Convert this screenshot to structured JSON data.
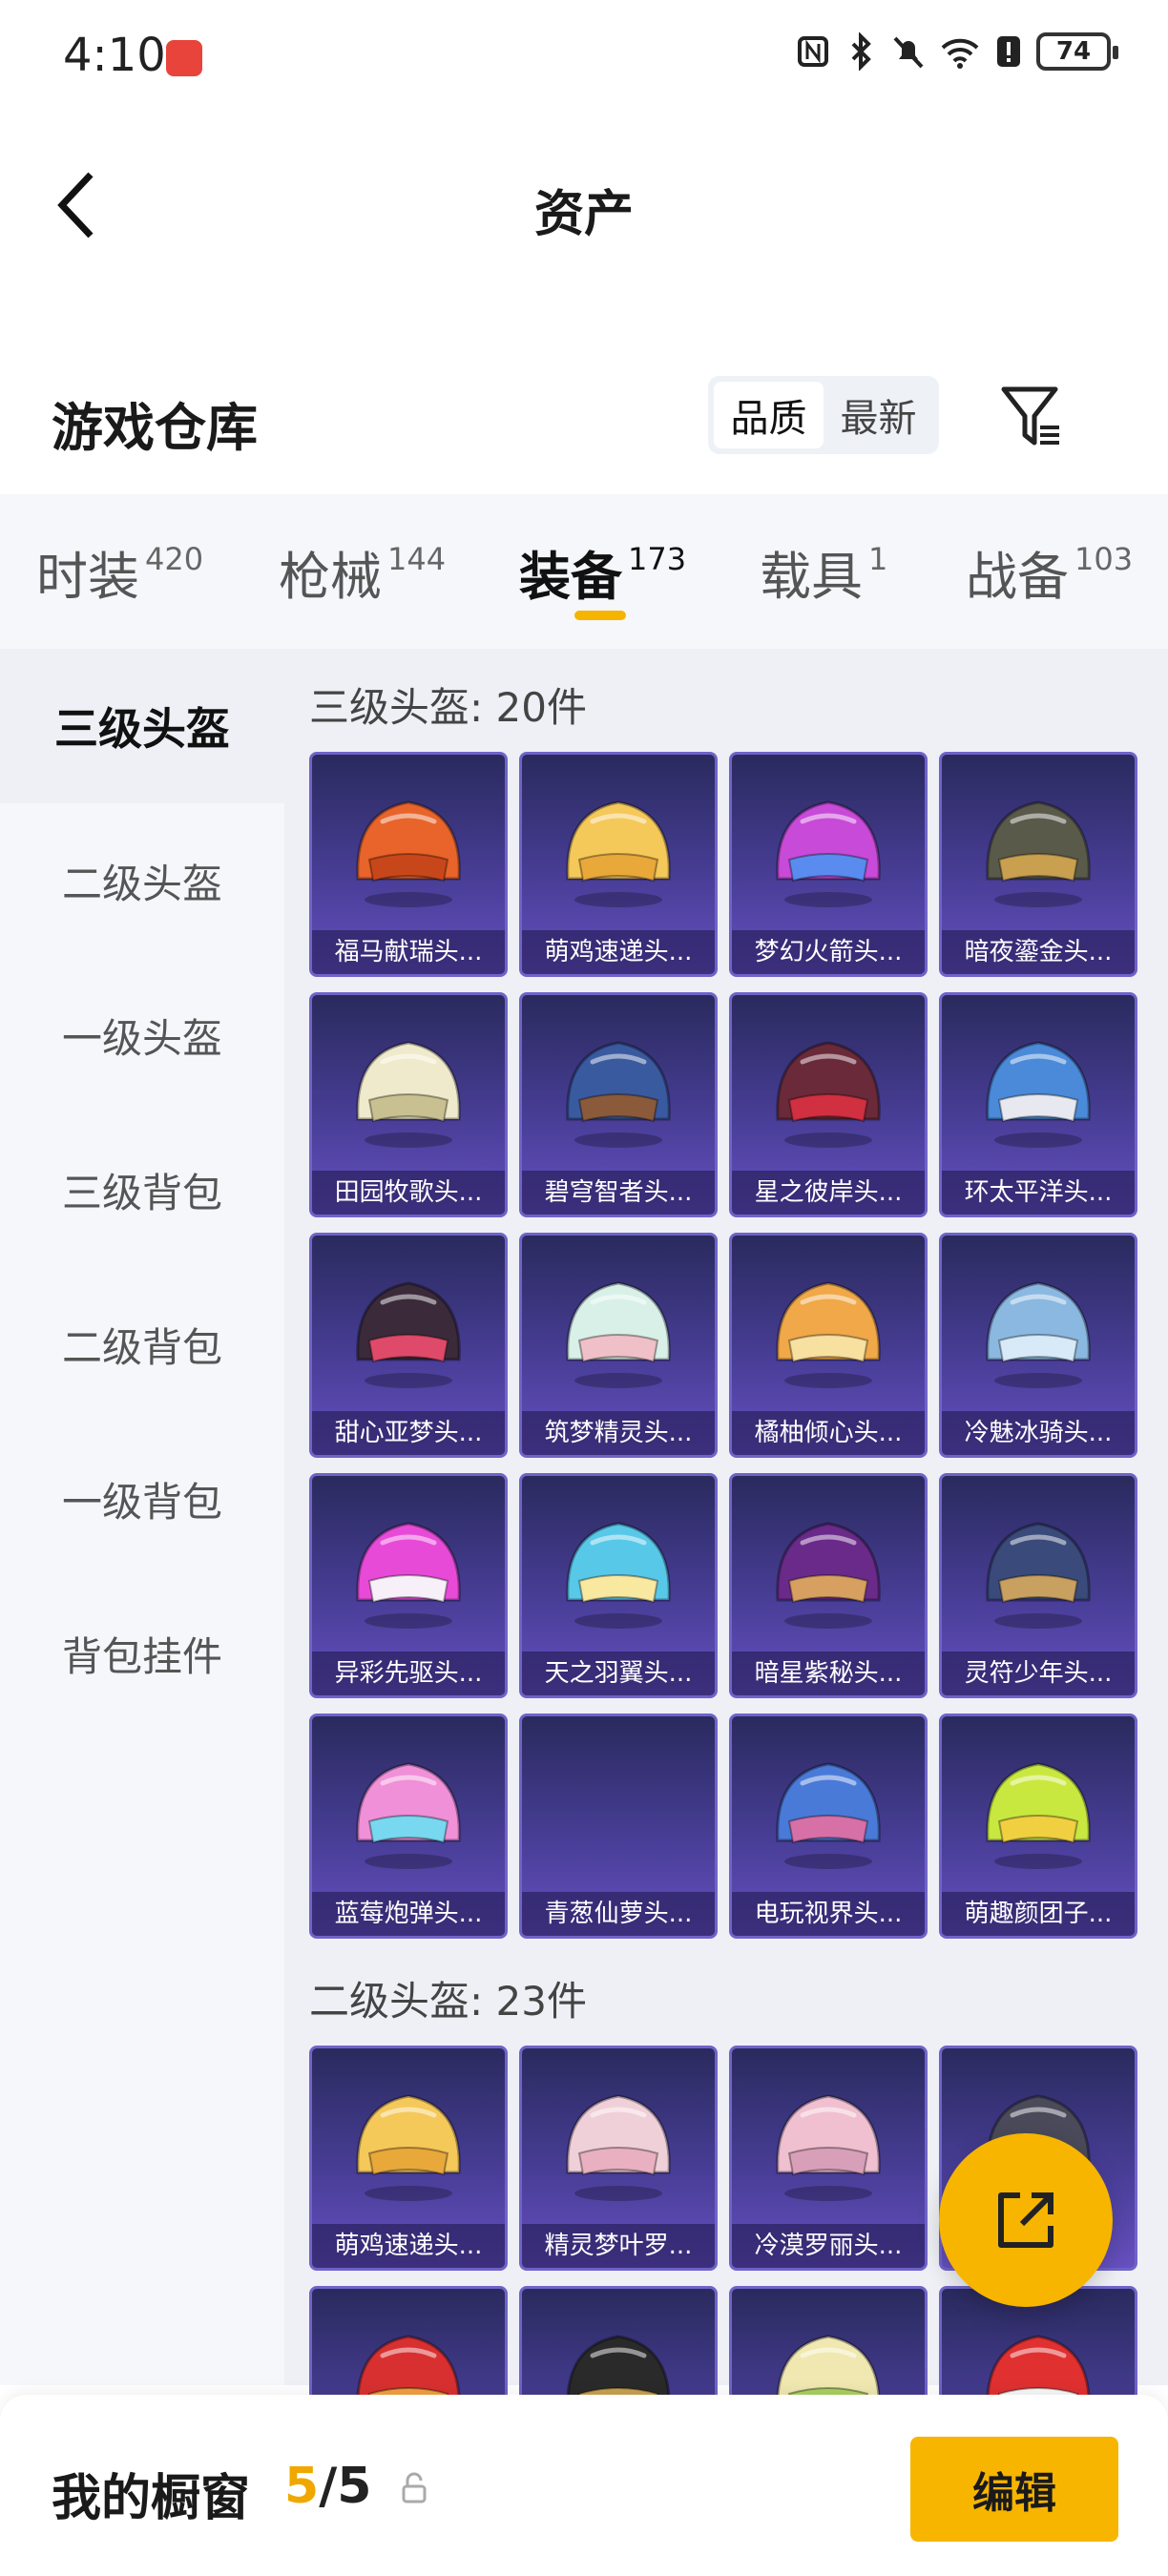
{
  "status_bar": {
    "time": "4:10",
    "battery": "74"
  },
  "nav": {
    "title": "资产"
  },
  "warehouse": {
    "title": "游戏仓库",
    "sort_options": [
      "品质",
      "最新"
    ],
    "sort_selected": "品质"
  },
  "tabs": [
    {
      "label": "时装",
      "count": "420"
    },
    {
      "label": "枪械",
      "count": "144"
    },
    {
      "label": "装备",
      "count": "173"
    },
    {
      "label": "载具",
      "count": "1"
    },
    {
      "label": "战备",
      "count": "103"
    }
  ],
  "active_tab": "装备",
  "sidebar": {
    "items": [
      "三级头盔",
      "二级头盔",
      "一级头盔",
      "三级背包",
      "二级背包",
      "一级背包",
      "背包挂件"
    ],
    "active": "三级头盔"
  },
  "sections": [
    {
      "title": "三级头盔: 20件",
      "items": [
        {
          "name": "福马献瑞头...",
          "icon": "fox-helmet-orange"
        },
        {
          "name": "萌鸡速递头...",
          "icon": "chick-helmet-yellow"
        },
        {
          "name": "梦幻火箭头...",
          "icon": "rocket-helmet-purple"
        },
        {
          "name": "暗夜鎏金头...",
          "icon": "crown-helmet-gold"
        },
        {
          "name": "田园牧歌头...",
          "icon": "flower-helmet-cream"
        },
        {
          "name": "碧穹智者头...",
          "icon": "horse-helmet-blue"
        },
        {
          "name": "星之彼岸头...",
          "icon": "red-visor-helmet"
        },
        {
          "name": "环太平洋头...",
          "icon": "mecha-helmet-blue"
        },
        {
          "name": "甜心亚梦头...",
          "icon": "cyber-helmet-pink"
        },
        {
          "name": "筑梦精灵头...",
          "icon": "fairy-helmet-mint"
        },
        {
          "name": "橘柚倾心头...",
          "icon": "cake-helmet-orange"
        },
        {
          "name": "冷魅冰骑头...",
          "icon": "ice-helmet-blue"
        },
        {
          "name": "异彩先驱头...",
          "icon": "robot-helmet-pink"
        },
        {
          "name": "天之羽翼头...",
          "icon": "wing-helmet-cyan"
        },
        {
          "name": "暗星紫秘头...",
          "icon": "dark-helmet-purple"
        },
        {
          "name": "灵符少年头...",
          "icon": "talisman-helmet-navy"
        },
        {
          "name": "蓝莓炮弹头...",
          "icon": "bunny-helmet-pink"
        },
        {
          "name": "青葱仙萝头...",
          "icon": "empty"
        },
        {
          "name": "电玩视界头...",
          "icon": "game-helmet-blue"
        },
        {
          "name": "萌趣颜团子...",
          "icon": "sprout-helmet-green"
        }
      ]
    },
    {
      "title": "二级头盔: 23件",
      "items": [
        {
          "name": "萌鸡速递头...",
          "icon": "chick-helmet-yellow"
        },
        {
          "name": "精灵梦叶罗...",
          "icon": "pig-helmet-pink"
        },
        {
          "name": "冷漠罗丽头...",
          "icon": "pig-helmet-rose"
        },
        {
          "name": "",
          "icon": "moto-helmet-gray"
        },
        {
          "name": "",
          "icon": "moto-helmet-red"
        },
        {
          "name": "",
          "icon": "helmet-black"
        },
        {
          "name": "",
          "icon": "sprout-helmet-cream"
        },
        {
          "name": "",
          "icon": "bear-helmet-red"
        }
      ]
    }
  ],
  "bottom_bar": {
    "label": "我的橱窗",
    "current": "5",
    "separator": "/",
    "total": "5",
    "edit_label": "编辑"
  },
  "colors": {
    "accent": "#f7b500",
    "card_bg": "#4a3f9a",
    "tab_indicator": "#f6b300"
  }
}
